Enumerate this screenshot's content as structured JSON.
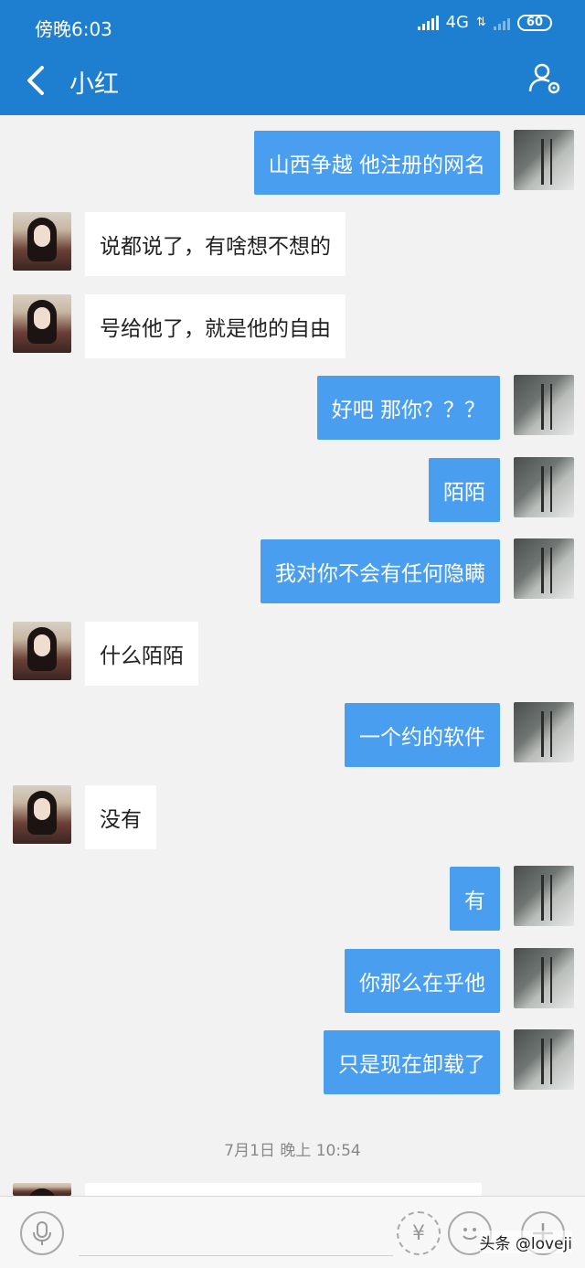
{
  "status_bar": {
    "time": "傍晚6:03",
    "network": "4G",
    "battery": "60"
  },
  "header": {
    "title": "小红"
  },
  "messages": [
    {
      "side": "right",
      "text": "山西争越  他注册的网名"
    },
    {
      "side": "left",
      "text": "说都说了，有啥想不想的"
    },
    {
      "side": "left",
      "text": "号给他了，就是他的自由"
    },
    {
      "side": "right",
      "text": "好吧   那你？？？"
    },
    {
      "side": "right",
      "text": "陌陌"
    },
    {
      "side": "right",
      "text": "我对你不会有任何隐瞒"
    },
    {
      "side": "left",
      "text": "什么陌陌"
    },
    {
      "side": "right",
      "text": "一个约的软件"
    },
    {
      "side": "left",
      "text": "没有"
    },
    {
      "side": "right",
      "text": "有"
    },
    {
      "side": "right",
      "text": "你那么在乎他"
    },
    {
      "side": "right",
      "text": "只是现在卸载了"
    }
  ],
  "timestamp": "7月1日 晚上 10:54",
  "input_bar": {
    "money_symbol": "¥"
  },
  "watermark": "头条 @loveji"
}
